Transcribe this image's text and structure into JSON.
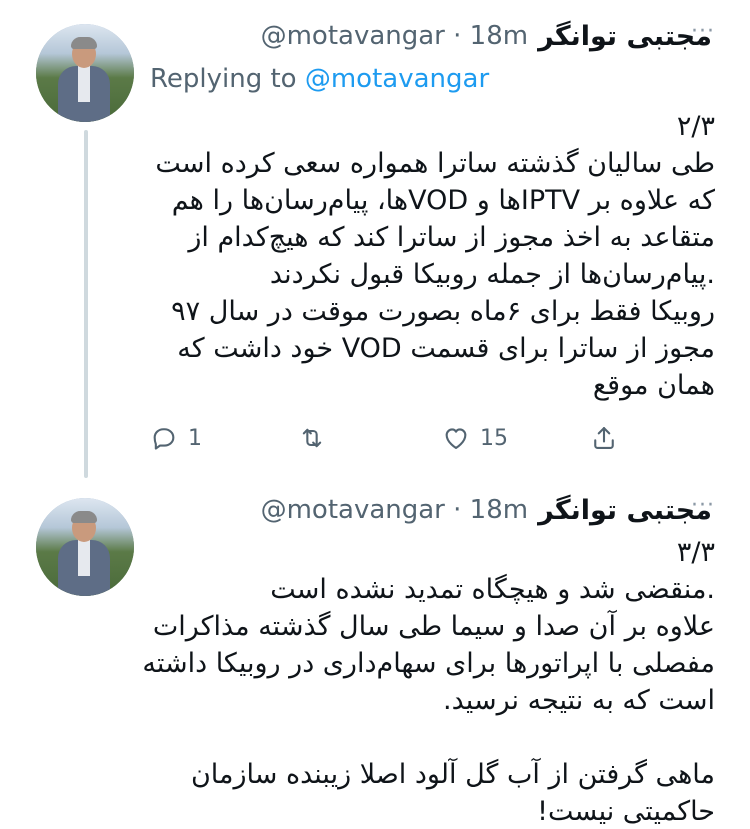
{
  "tweets": [
    {
      "display_name": "مجتبی توانگر",
      "handle": "@motavangar",
      "time": "· 18m",
      "more": "···",
      "replying_prefix": "Replying to",
      "replying_to": "@motavangar",
      "lines": [
        "۲/۳",
        "طی سالیان گذشته ساترا همواره سعی کرده است",
        "که علاوه بر IPTVها و VODها، پیام‌رسان‌ها را هم",
        "متقاعد به اخذ مجوز از ساترا کند که هیچ‌کدام از",
        ".پیام‌رسان‌ها از جمله روبیکا قبول نکردند",
        "روبیکا فقط برای ۶ماه بصورت موقت در سال ۹۷",
        "مجوز از ساترا برای قسمت VOD خود داشت که",
        "همان موقع"
      ],
      "actions": {
        "reply_count": "1",
        "retweet_count": "",
        "like_count": "15",
        "reply_icon": "reply-icon",
        "retweet_icon": "retweet-icon",
        "like_icon": "heart-icon",
        "share_icon": "share-icon"
      }
    },
    {
      "display_name": "مجتبی توانگر",
      "handle": "@motavangar",
      "time": "· 18m",
      "more": "···",
      "lines": [
        "۳/۳",
        ".منقضی شد و هیچگاه تمدید نشده است",
        "علاوه بر آن صدا و سیما طی سال گذشته مذاکرات",
        "مفصلی با اپراتورها برای سهام‌داری در روبیکا داشته",
        "است که به نتیجه نرسید.",
        "",
        "ماهی گرفتن از آب گل آلود اصلا زیبنده سازمان",
        "حاکمیتی نیست!"
      ]
    }
  ],
  "colors": {
    "text": "#0f1419",
    "secondary": "#536471",
    "link": "#1d9bf0",
    "thread_line": "#cfd9de"
  }
}
